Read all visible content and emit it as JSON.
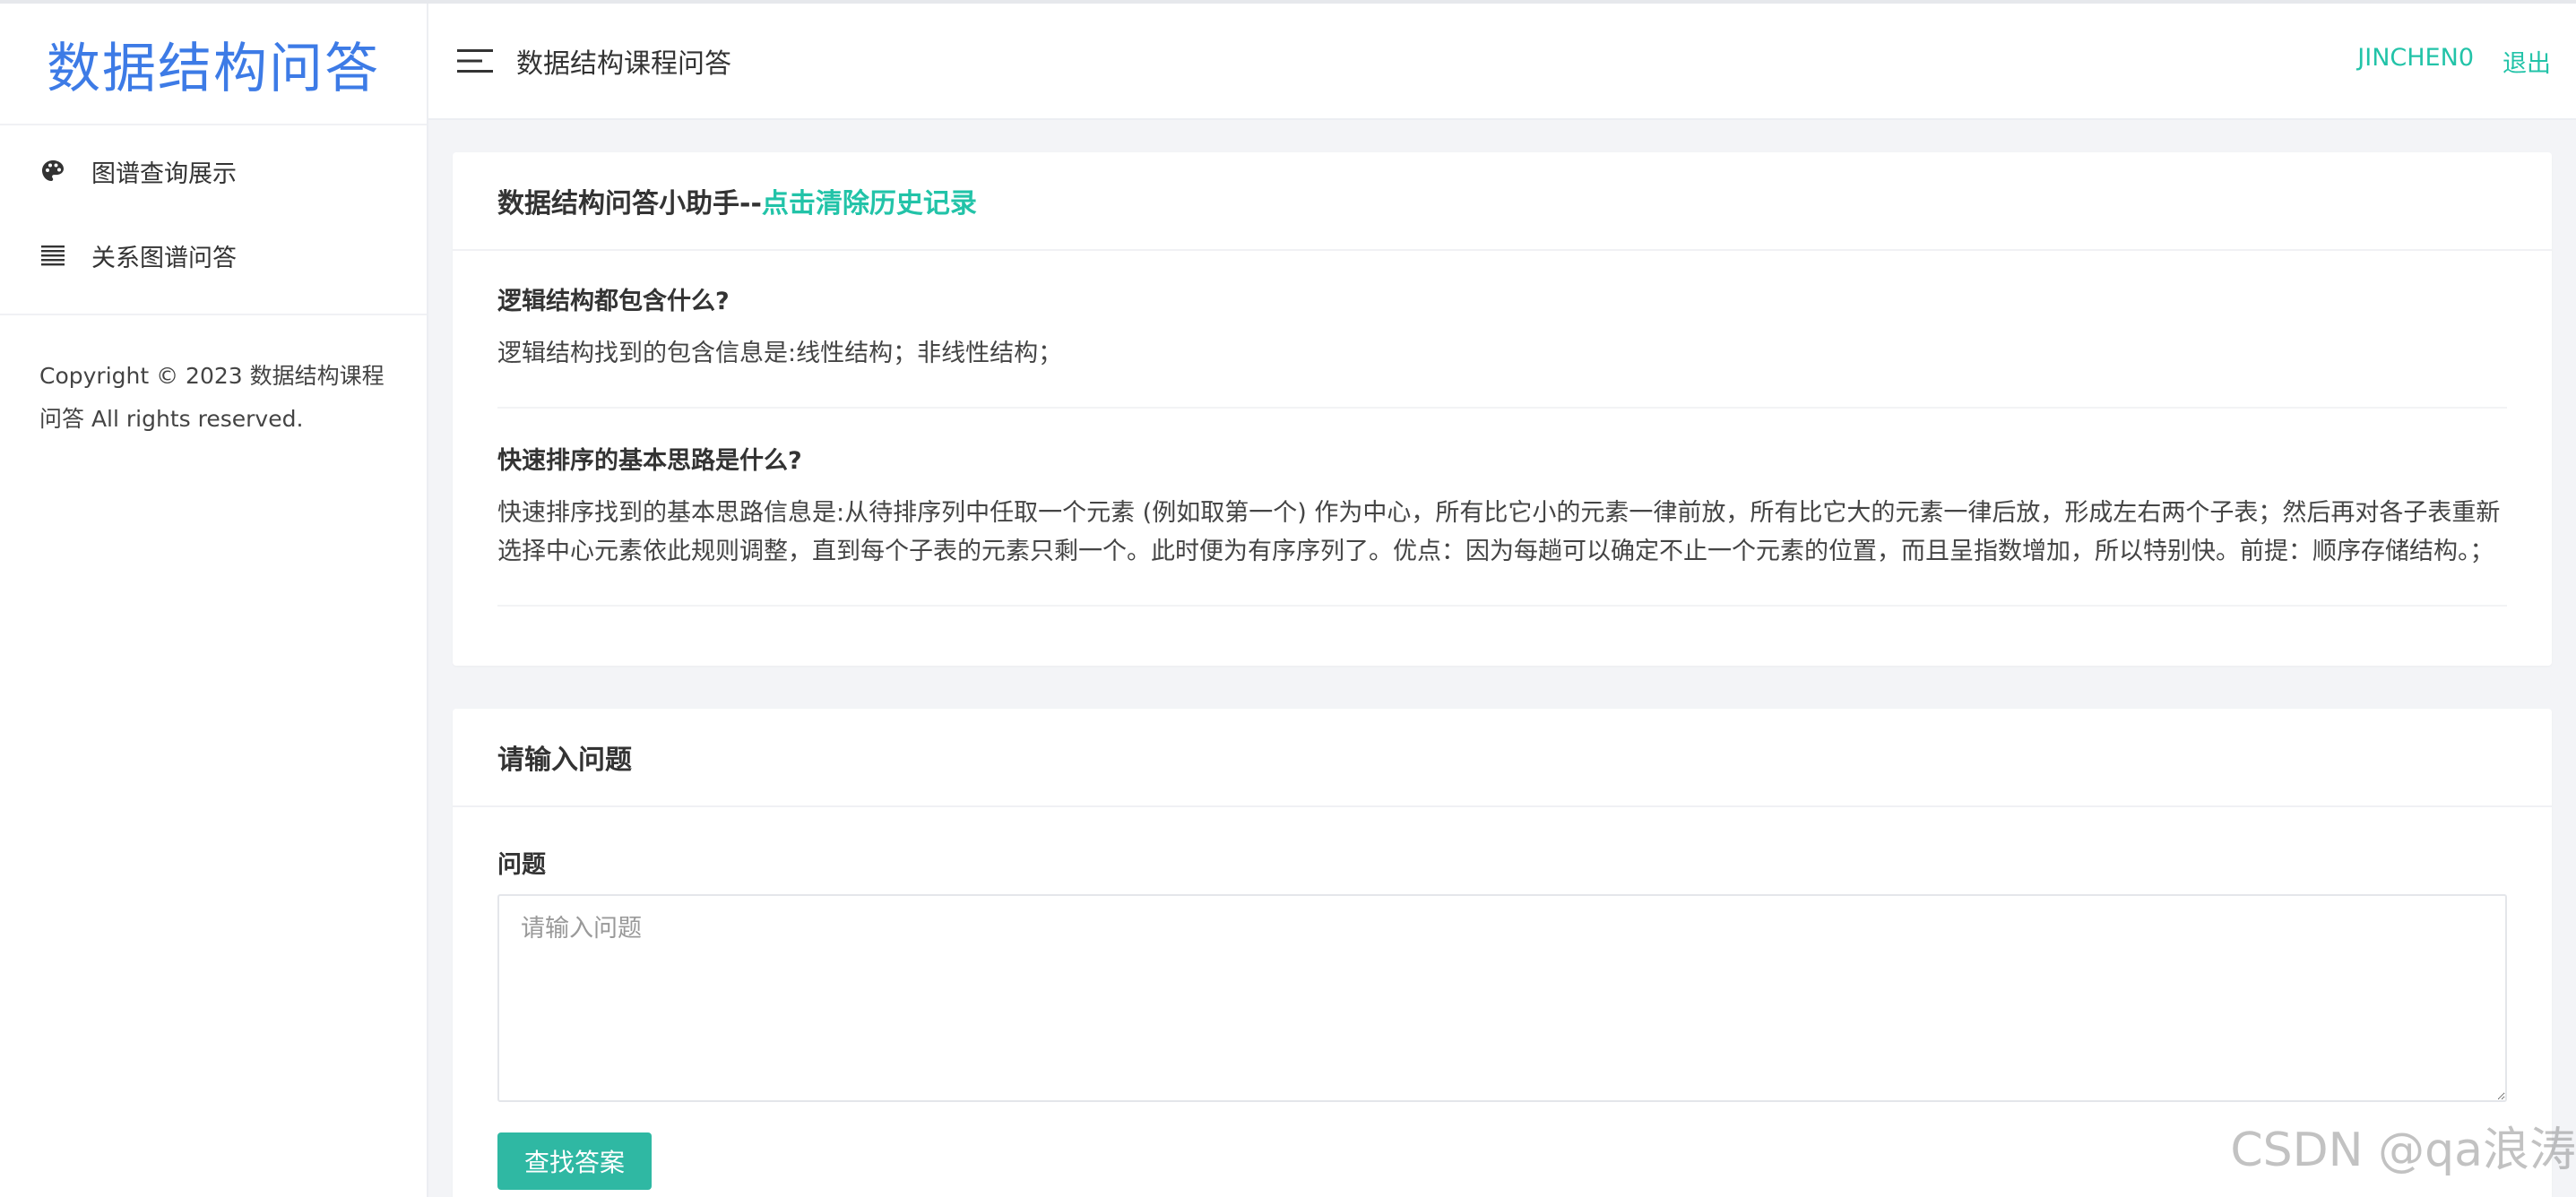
{
  "sidebar": {
    "logo": "数据结构问答",
    "items": [
      {
        "label": "图谱查询展示",
        "icon": "palette-icon"
      },
      {
        "label": "关系图谱问答",
        "icon": "list-icon"
      }
    ],
    "copyright": "Copyright © 2023 数据结构课程问答 All rights reserved."
  },
  "header": {
    "title": "数据结构课程问答",
    "user": "JINCHEN0",
    "logout": "退出"
  },
  "history": {
    "title_prefix": "数据结构问答小助手--",
    "clear_link": "点击清除历史记录",
    "items": [
      {
        "question": "逻辑结构都包含什么?",
        "answer": "逻辑结构找到的包含信息是:线性结构；非线性结构；"
      },
      {
        "question": "快速排序的基本思路是什么?",
        "answer": "快速排序找到的基本思路信息是:从待排序列中任取一个元素 (例如取第一个) 作为中心，所有比它小的元素一律前放，所有比它大的元素一律后放，形成左右两个子表；然后再对各子表重新选择中心元素依此规则调整，直到每个子表的元素只剩一个。此时便为有序序列了。优点：因为每趟可以确定不止一个元素的位置，而且呈指数增加，所以特别快。前提：顺序存储结构。；"
      }
    ]
  },
  "form": {
    "title": "请输入问题",
    "label": "问题",
    "placeholder": "请输入问题",
    "value": "",
    "submit": "查找答案"
  },
  "watermark": "CSDN @qa浪涛",
  "colors": {
    "accent": "#22c3a8",
    "logo": "#3d7be6",
    "button": "#2fb8a3"
  }
}
